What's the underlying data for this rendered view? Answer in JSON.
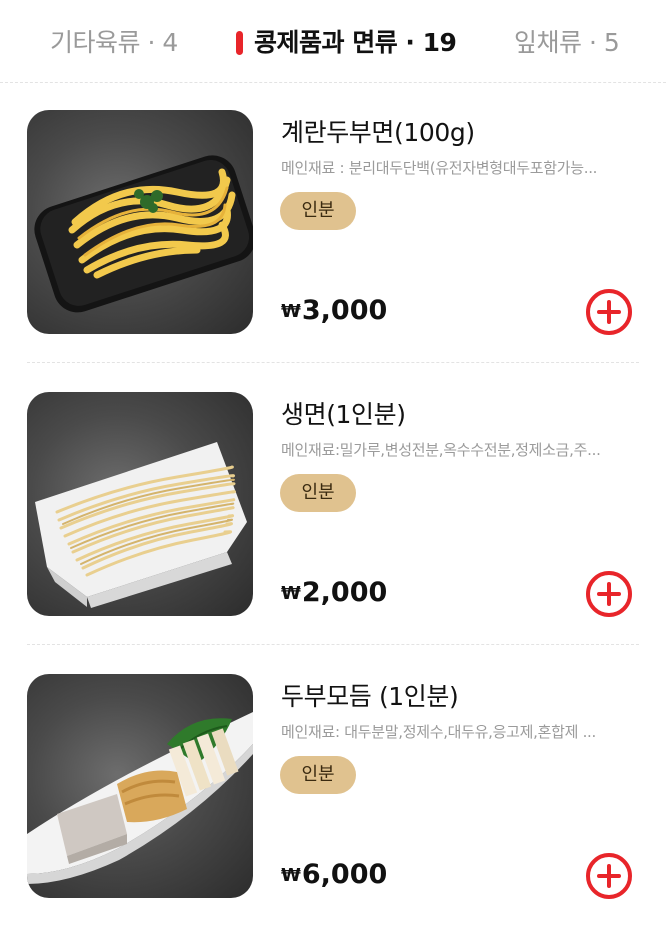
{
  "tabs": [
    {
      "label": "기타육류 · 4",
      "active": false
    },
    {
      "label": "콩제품과 면류 · 19",
      "active": true
    },
    {
      "label": "잎채류 · 5",
      "active": false
    }
  ],
  "colors": {
    "accent": "#e8252a",
    "badge_bg": "#e0c28f",
    "muted_text": "#9b9b9b"
  },
  "currency_symbol": "₩",
  "items": [
    {
      "name": "계란두부면(100g)",
      "description": "메인재료 : 분리대두단백(유전자변형대두포함가능...",
      "badge": "인분",
      "price": "3,000",
      "image_icon": "egg-tofu-noodle-photo",
      "add_icon": "plus-circle-icon"
    },
    {
      "name": "생면(1인분)",
      "description": "메인재료:밀가루,변성전분,옥수수전분,정제소금,주...",
      "badge": "인분",
      "price": "2,000",
      "image_icon": "fresh-noodle-photo",
      "add_icon": "plus-circle-icon"
    },
    {
      "name": "두부모듬 (1인분)",
      "description": "메인재료: 대두분말,정제수,대두유,응고제,혼합제 ...",
      "badge": "인분",
      "price": "6,000",
      "image_icon": "tofu-assortment-photo",
      "add_icon": "plus-circle-icon"
    }
  ]
}
